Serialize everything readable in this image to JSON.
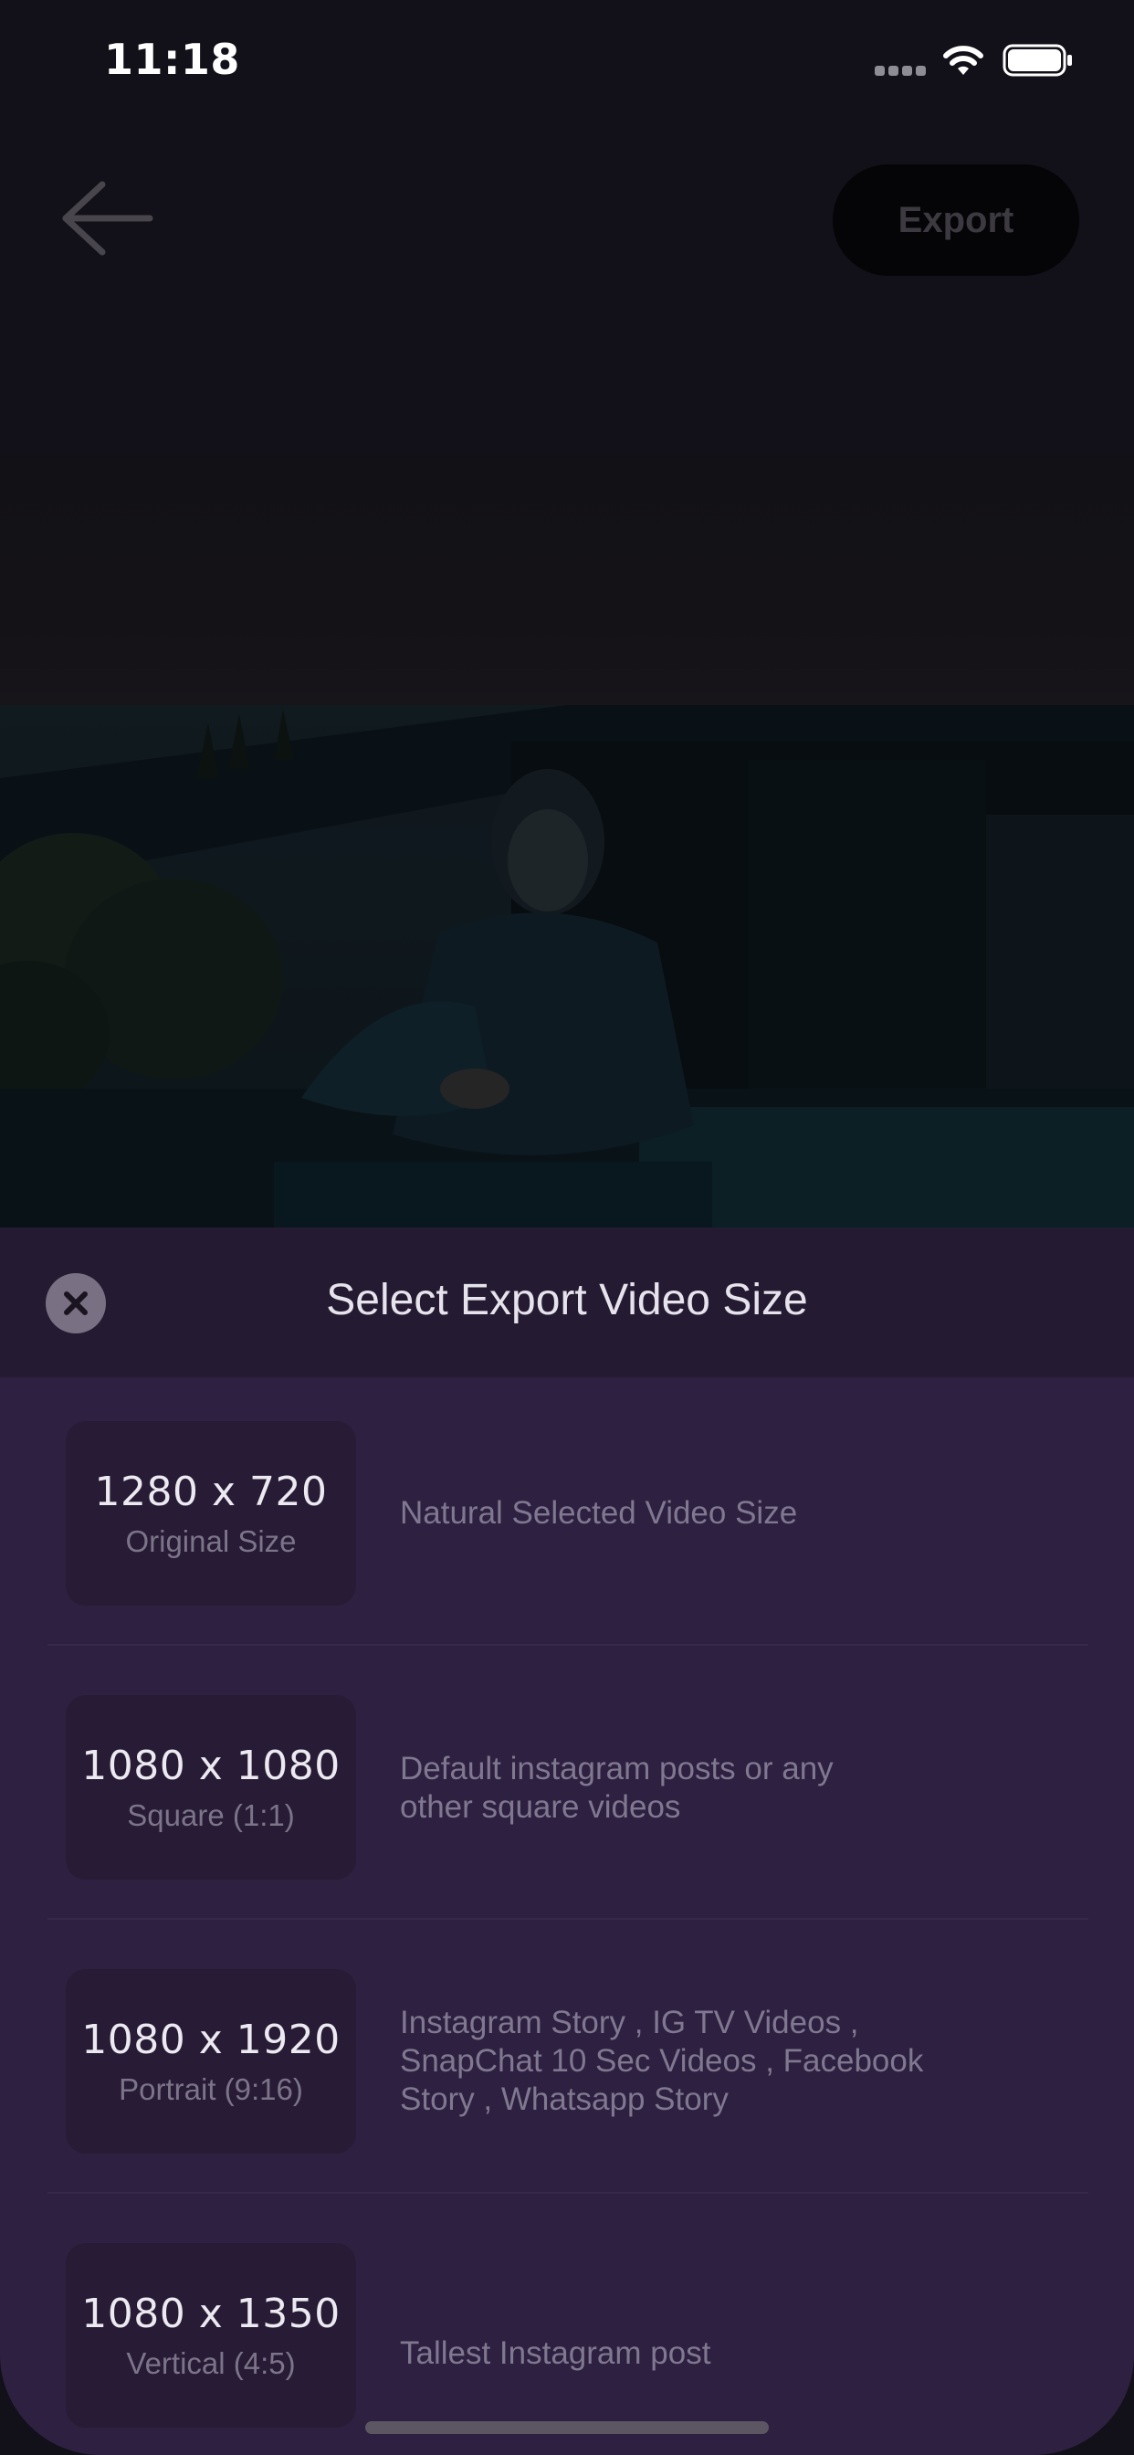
{
  "status_bar": {
    "time": "11:18"
  },
  "nav": {
    "export_label": "Export"
  },
  "sheet": {
    "title": "Select Export Video Size",
    "options": [
      {
        "size": "1280 x 720",
        "label": "Original Size",
        "description": "Natural Selected Video Size"
      },
      {
        "size": "1080 x 1080",
        "label": "Square (1:1)",
        "description": "Default instagram posts or any other square videos"
      },
      {
        "size": "1080 x 1920",
        "label": "Portrait (9:16)",
        "description": "Instagram Story , IG TV Videos , SnapChat 10 Sec Videos , Facebook Story , Whatsapp Story"
      },
      {
        "size": "1080 x 1350",
        "label": "Vertical (4:5)",
        "description": "Tallest Instagram post"
      }
    ]
  },
  "colors": {
    "sheet_background": "#2e2040",
    "sheet_header": "#241a32",
    "card_background": "#271b36",
    "close_button": "#7a7084"
  }
}
